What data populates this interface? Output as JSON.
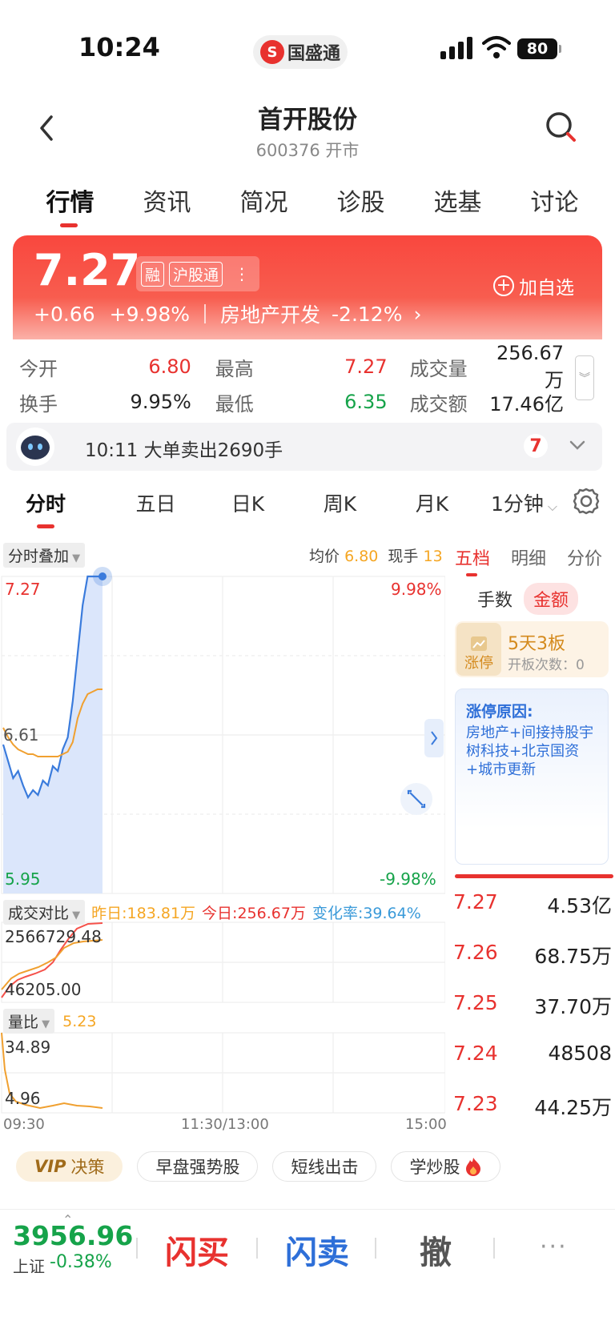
{
  "status": {
    "time": "10:24",
    "app_name": "国盛通",
    "battery": "80"
  },
  "header": {
    "title": "首开股份",
    "subtitle": "600376 开市"
  },
  "tabs": [
    "行情",
    "资讯",
    "简况",
    "诊股",
    "选基",
    "讨论"
  ],
  "quote": {
    "price": "7.27",
    "tags": [
      "融",
      "沪股通"
    ],
    "change": "+0.66",
    "change_pct": "+9.98%",
    "sector": "房地产开发",
    "sector_pct": "-2.12%",
    "add_watch": "加自选"
  },
  "stats": {
    "open_label": "今开",
    "open": "6.80",
    "high_label": "最高",
    "high": "7.27",
    "volume_label": "成交量",
    "volume": "256.67万",
    "turnover_label": "换手",
    "turnover": "9.95%",
    "low_label": "最低",
    "low": "6.35",
    "amount_label": "成交额",
    "amount": "17.46亿"
  },
  "news": {
    "text": "10:11 大单卖出2690手",
    "count": "7"
  },
  "chart_tabs": [
    "分时",
    "五日",
    "日K",
    "周K",
    "月K",
    "1分钟"
  ],
  "chart": {
    "overlay_label": "分时叠加",
    "avg_label": "均价",
    "avg_value": "6.80",
    "cur_label": "现手",
    "cur_value": "13",
    "y_top": "7.27",
    "y_mid": "6.61",
    "y_bottom": "5.95",
    "pct_top": "9.98%",
    "pct_bottom": "-9.98%",
    "vol_compare_label": "成交对比",
    "yesterday": "昨日:183.81万",
    "today": "今日:256.67万",
    "change_rate": "变化率:39.64%",
    "vol_top": "2566729.48",
    "vol_bottom": "46205.00",
    "ratio_label": "量比",
    "ratio_value": "5.23",
    "ratio_top": "34.89",
    "ratio_bottom": "4.96",
    "x_start": "09:30",
    "x_mid": "11:30/13:00",
    "x_end": "15:00"
  },
  "chart_data": {
    "type": "line",
    "title": "",
    "x": [
      "09:30",
      "09:32",
      "09:34",
      "09:36",
      "09:38",
      "09:40",
      "09:42",
      "09:44",
      "09:46",
      "09:48",
      "09:50",
      "09:52",
      "09:54",
      "09:56",
      "09:58",
      "10:00",
      "10:05",
      "10:10",
      "10:15",
      "10:20",
      "10:24"
    ],
    "series": [
      {
        "values": [
          6.57,
          6.5,
          6.43,
          6.46,
          6.4,
          6.35,
          6.38,
          6.36,
          6.42,
          6.4,
          6.48,
          6.46,
          6.55,
          6.6,
          6.75,
          6.95,
          7.15,
          7.27,
          7.27,
          7.27,
          7.27
        ]
      },
      {
        "values": [
          6.64,
          6.6,
          6.57,
          6.55,
          6.54,
          6.53,
          6.53,
          6.52,
          6.52,
          6.52,
          6.52,
          6.52,
          6.53,
          6.54,
          6.58,
          6.68,
          6.74,
          6.78,
          6.79,
          6.8,
          6.8
        ]
      }
    ],
    "ylim": [
      5.95,
      7.27
    ]
  },
  "right_panel": {
    "tabs": [
      "五档",
      "明细",
      "分价"
    ],
    "seg": [
      "手数",
      "金额"
    ],
    "limit_badge": "涨停",
    "limit_title": "5天3板",
    "limit_sub": "开板次数：0",
    "reason_title": "涨停原因:",
    "reason_body": "房地产+间接持股宇树科技+北京国资+城市更新",
    "book": [
      {
        "price": "7.27",
        "vol": "4.53亿"
      },
      {
        "price": "7.26",
        "vol": "68.75万"
      },
      {
        "price": "7.25",
        "vol": "37.70万"
      },
      {
        "price": "7.24",
        "vol": "48508"
      },
      {
        "price": "7.23",
        "vol": "44.25万"
      }
    ]
  },
  "chips": [
    "VIP",
    "决策",
    "早盘强势股",
    "短线出击",
    "学炒股"
  ],
  "bottom": {
    "index_value": "3956.96",
    "index_name": "上证",
    "index_change": "-0.38%",
    "buy": "闪买",
    "sell": "闪卖",
    "cancel": "撤",
    "more": "···"
  }
}
